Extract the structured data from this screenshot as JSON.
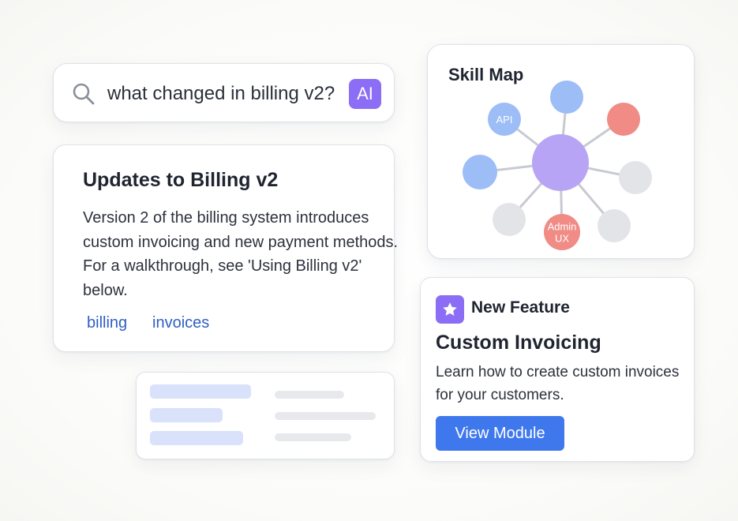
{
  "search": {
    "query": "what changed in billing v2?",
    "ai_badge": "AI"
  },
  "article": {
    "title": "Updates to Billing v2",
    "body": "Version 2 of the billing system introduces custom invoicing and new payment methods. For a walkthrough, see 'Using Billing v2' below.",
    "tags": [
      "billing",
      "invoices"
    ]
  },
  "skill_map": {
    "title": "Skill Map",
    "nodes": [
      {
        "label": "API",
        "color": "#9dbdf7"
      },
      {
        "label": "",
        "color": "#9dbdf7"
      },
      {
        "label": "",
        "color": "#f08b86"
      },
      {
        "label": "",
        "color": "#9dbdf7"
      },
      {
        "label": "",
        "color": "#e3e4e8"
      },
      {
        "label": "",
        "color": "#e3e4e8"
      },
      {
        "label": "Admin UX",
        "color": "#f08b86"
      },
      {
        "label": "",
        "color": "#e3e4e8"
      }
    ],
    "center_color": "#b8a4f4"
  },
  "feature": {
    "label": "New Feature",
    "title": "Custom Invoicing",
    "description": "Learn how to create custom invoices for your customers.",
    "button_label": "View Module",
    "icon": "star-icon"
  },
  "colors": {
    "accent_purple": "#8b6ef5",
    "link_blue": "#2f5fc4",
    "button_blue": "#3f78ec"
  }
}
